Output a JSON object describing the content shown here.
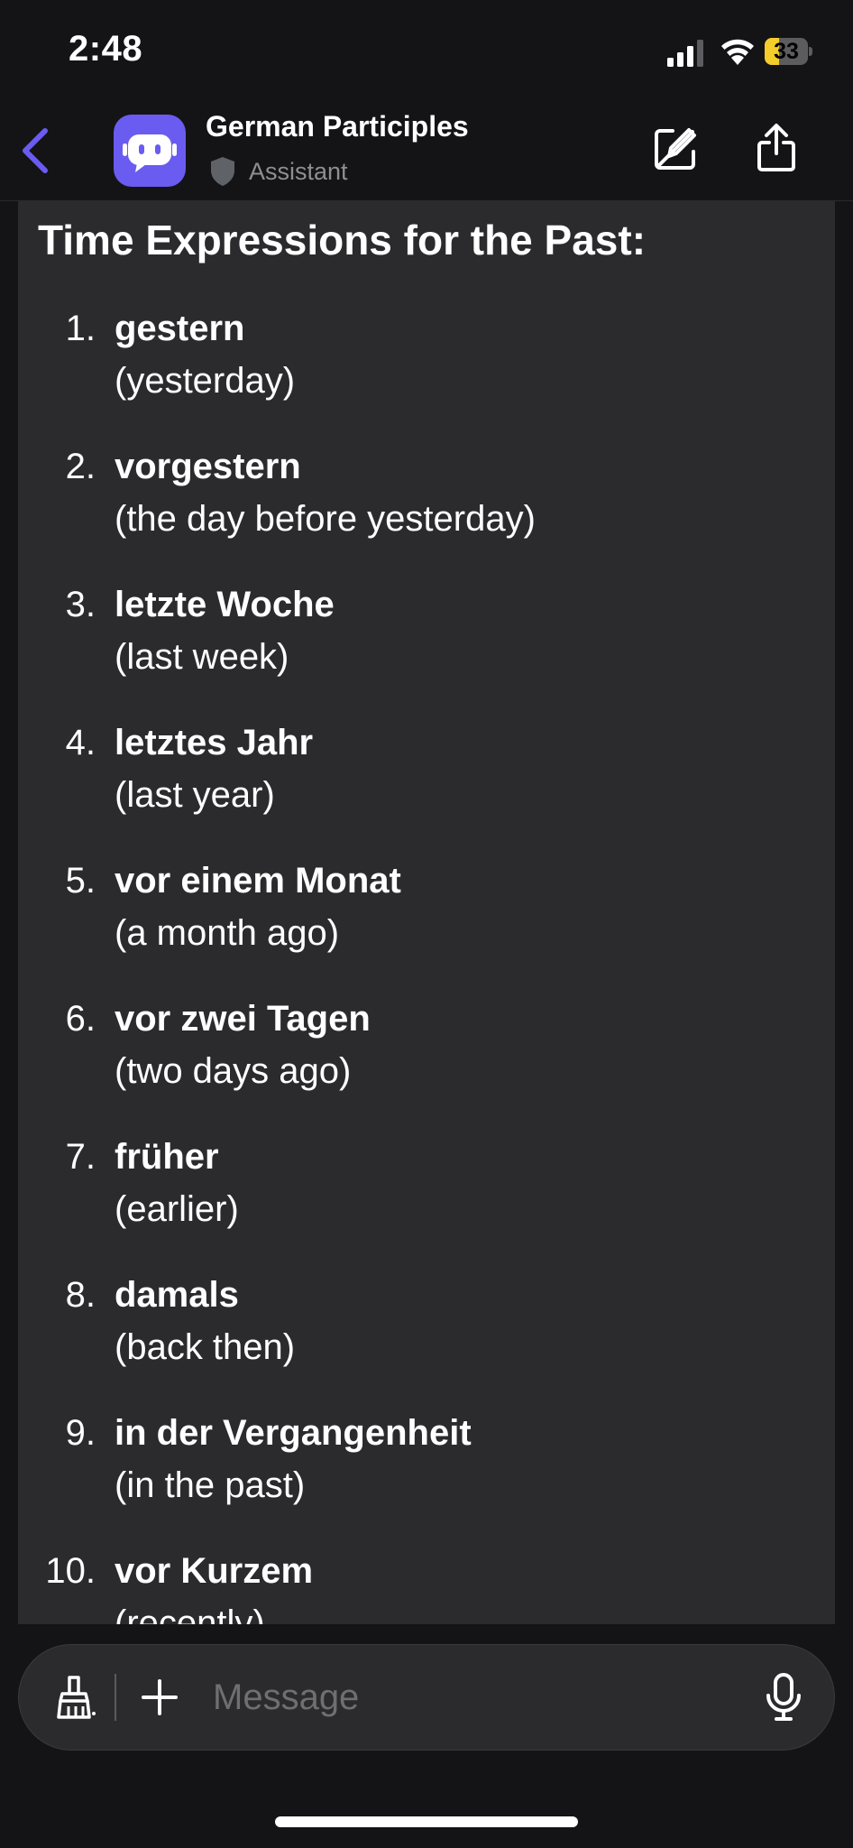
{
  "status_bar": {
    "time": "2:48",
    "battery": "33",
    "battery_level": 0.33
  },
  "header": {
    "title": "German Participles",
    "subtitle": "Assistant",
    "icons": {
      "back": "chevron-left-icon",
      "avatar": "bot-icon",
      "badge": "shield-icon",
      "edit": "edit-icon",
      "share": "share-icon"
    },
    "accent": "#6a5cf0"
  },
  "message": {
    "heading": "Time Expressions for the Past:",
    "items": [
      {
        "num": "1.",
        "term": "gestern",
        "translation": "(yesterday)"
      },
      {
        "num": "2.",
        "term": "vorgestern",
        "translation": "(the day before yesterday)"
      },
      {
        "num": "3.",
        "term": "letzte Woche",
        "translation": "(last week)"
      },
      {
        "num": "4.",
        "term": "letztes Jahr",
        "translation": "(last year)"
      },
      {
        "num": "5.",
        "term": "vor einem Monat",
        "translation": "(a month ago)"
      },
      {
        "num": "6.",
        "term": "vor zwei Tagen",
        "translation": "(two days ago)"
      },
      {
        "num": "7.",
        "term": "früher",
        "translation": "(earlier)"
      },
      {
        "num": "8.",
        "term": "damals",
        "translation": "(back then)"
      },
      {
        "num": "9.",
        "term": "in der Vergangenheit",
        "translation": "(in the past)"
      },
      {
        "num": "10.",
        "term": "vor Kurzem",
        "translation": "(recently)"
      }
    ]
  },
  "composer": {
    "placeholder": "Message",
    "icons": {
      "clear": "broom-icon",
      "add": "plus-icon",
      "mic": "microphone-icon"
    }
  }
}
